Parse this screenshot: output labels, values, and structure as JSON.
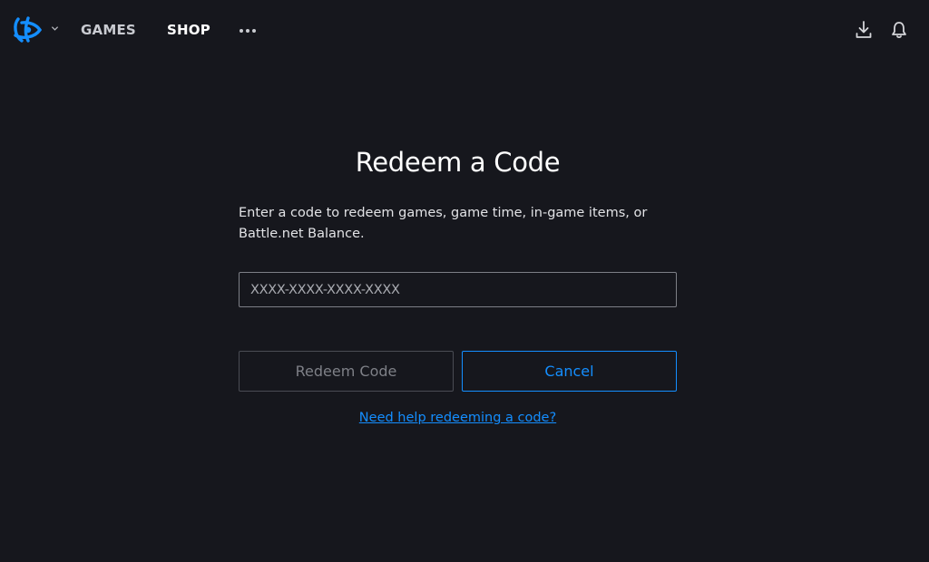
{
  "nav": {
    "items": [
      {
        "label": "GAMES"
      },
      {
        "label": "SHOP"
      }
    ],
    "icons": {
      "logo": "battlenet-logo-icon",
      "logo_menu": "chevron-down-icon",
      "more": "more-horizontal-icon",
      "download": "download-icon",
      "notifications": "bell-icon"
    }
  },
  "redeem": {
    "title": "Redeem a Code",
    "description": "Enter a code to redeem games, game time, in-game items, or Battle.net Balance.",
    "input": {
      "placeholder": "XXXX-XXXX-XXXX-XXXX",
      "value": ""
    },
    "redeem_button": "Redeem Code",
    "cancel_button": "Cancel",
    "help_link": "Need help redeeming a code?"
  },
  "colors": {
    "background": "#16171d",
    "accent": "#148eff",
    "brand_logo": "#148eff"
  }
}
